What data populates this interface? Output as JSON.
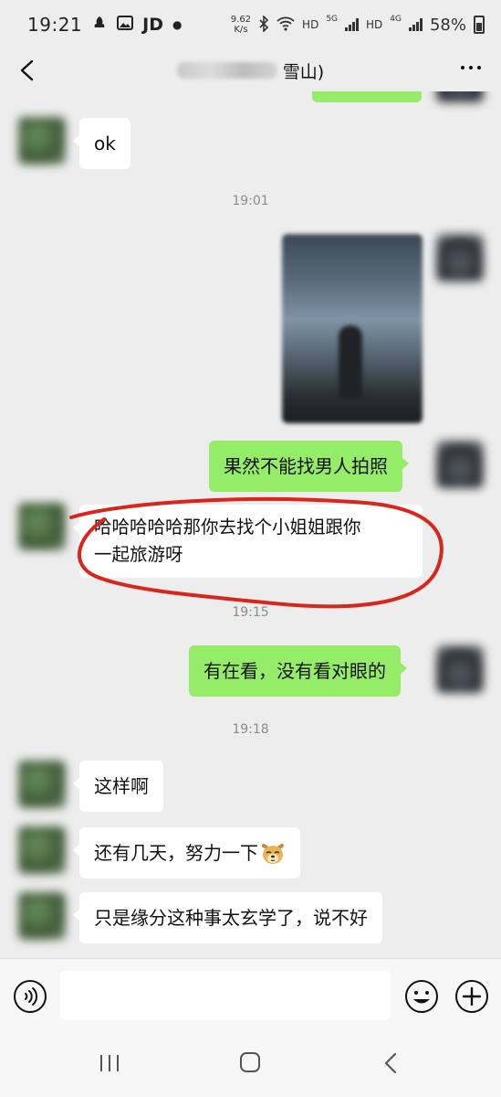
{
  "status_bar": {
    "time": "19:21",
    "app_label": "JD",
    "net_speed_value": "9.62",
    "net_speed_unit": "K/s",
    "hd1": "HD",
    "net_5g": "5G",
    "hd2": "HD",
    "net_4g": "4G",
    "battery": "58%"
  },
  "header": {
    "title_visible": "雪山)"
  },
  "messages": {
    "m1": "ok",
    "t1": "19:01",
    "m3": "果然不能找男人拍照",
    "m4_line1": "哈哈哈哈哈那你去找个小姐姐跟你",
    "m4_line2": "一起旅游呀",
    "t2": "19:15",
    "m5": "有在看，没有看对眼的",
    "t3": "19:18",
    "m6": "这样啊",
    "m7": "还有几天，努力一下",
    "m8": "只是缘分这种事太玄学了，说不好"
  },
  "emoji_m7": "dog-face-emoji",
  "colors": {
    "background": "#ededed",
    "outgoing_bubble": "#95ec69",
    "incoming_bubble": "#ffffff",
    "annotation": "#d9261c"
  }
}
